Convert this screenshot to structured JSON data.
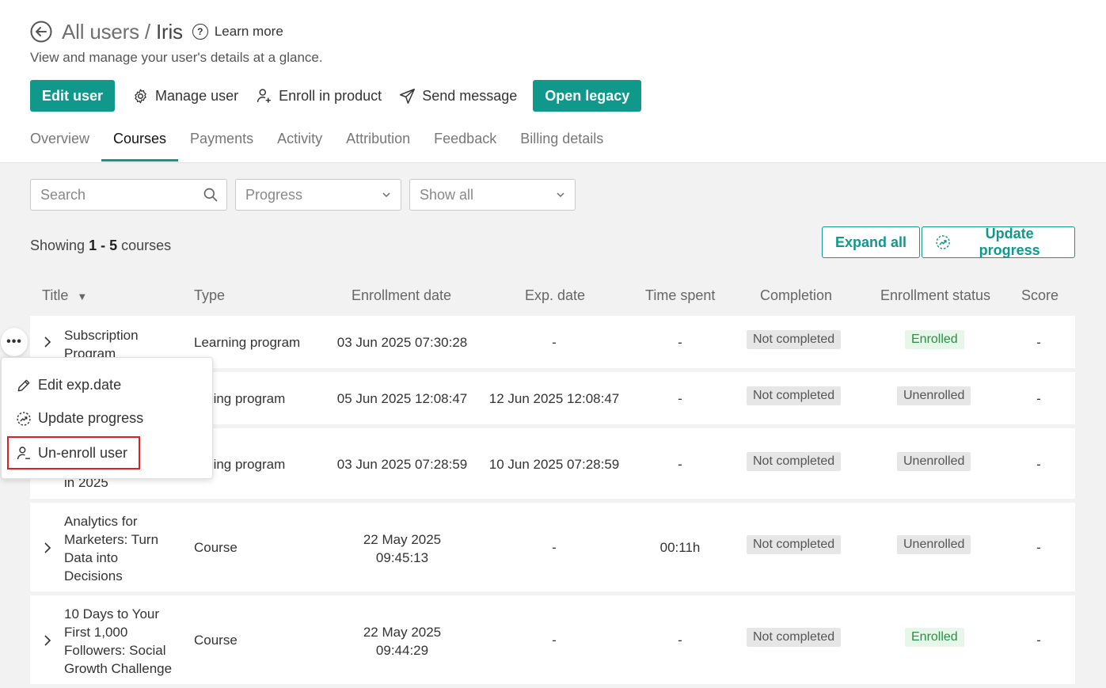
{
  "header": {
    "breadcrumb_root": "All users",
    "separator": " / ",
    "user_name": "Iris",
    "learn_more": "Learn more",
    "subtitle": "View and manage your user's details at a glance."
  },
  "actions": {
    "edit_user": "Edit user",
    "manage_user": "Manage user",
    "enroll_in_product": "Enroll in product",
    "send_message": "Send message",
    "open_legacy": "Open legacy"
  },
  "tabs": [
    {
      "label": "Overview"
    },
    {
      "label": "Courses"
    },
    {
      "label": "Payments"
    },
    {
      "label": "Activity"
    },
    {
      "label": "Attribution"
    },
    {
      "label": "Feedback"
    },
    {
      "label": "Billing details"
    }
  ],
  "active_tab": "Courses",
  "filters": {
    "search_placeholder": "Search",
    "progress_placeholder": "Progress",
    "show_all": "Show all"
  },
  "summary": {
    "prefix": "Showing ",
    "range": "1 - 5",
    "suffix": " courses"
  },
  "buttons": {
    "expand_all": "Expand all",
    "update_progress": "Update progress"
  },
  "columns": {
    "title": "Title",
    "type": "Type",
    "enrollment_date": "Enrollment date",
    "exp_date": "Exp. date",
    "time_spent": "Time spent",
    "completion": "Completion",
    "enrollment_status": "Enrollment status",
    "score": "Score"
  },
  "rows": [
    {
      "title_lines": [
        "Subscription",
        "Program"
      ],
      "type": "Learning program",
      "enrollment_date": "03 Jun 2025 07:30:28",
      "exp_date": "-",
      "time_spent": "-",
      "completion": "Not completed",
      "status": "Enrolled",
      "score": "-"
    },
    {
      "title_lines": [],
      "type": "arning program",
      "enrollment_date": "05 Jun 2025 12:08:47",
      "exp_date": "12 Jun 2025 12:08:47",
      "time_spent": "-",
      "completion": "Not completed",
      "status": "Unenrolled",
      "score": "-"
    },
    {
      "title_lines": [
        "in 2025"
      ],
      "type": "arning program",
      "enrollment_date": "03 Jun 2025 07:28:59",
      "exp_date": "10 Jun 2025 07:28:59",
      "time_spent": "-",
      "completion": "Not completed",
      "status": "Unenrolled",
      "score": "-"
    },
    {
      "title_lines": [
        "Analytics for",
        "Marketers: Turn",
        "Data into",
        "Decisions"
      ],
      "type": "Course",
      "enrollment_date_lines": [
        "22 May 2025",
        "09:45:13"
      ],
      "exp_date": "-",
      "time_spent": "00:11h",
      "completion": "Not completed",
      "status": "Unenrolled",
      "score": "-"
    },
    {
      "title_lines": [
        "10 Days to Your",
        "First 1,000",
        "Followers: Social",
        "Growth Challenge"
      ],
      "type": "Course",
      "enrollment_date_lines": [
        "22 May 2025",
        "09:44:29"
      ],
      "exp_date": "-",
      "time_spent": "-",
      "completion": "Not completed",
      "status": "Enrolled",
      "score": "-"
    }
  ],
  "row_menu": {
    "trigger": "•••",
    "items": [
      {
        "label": "Edit exp.date",
        "icon": "pencil-icon"
      },
      {
        "label": "Update progress",
        "icon": "progress-icon"
      },
      {
        "label": "Un-enroll user",
        "icon": "user-remove-icon"
      }
    ]
  },
  "colors": {
    "accent": "#10998a",
    "highlight": "#e02020",
    "enrolled_bg": "#e6f6e9",
    "enrolled_text": "#2e8b47",
    "badge_grey": "#e6e6e6"
  }
}
